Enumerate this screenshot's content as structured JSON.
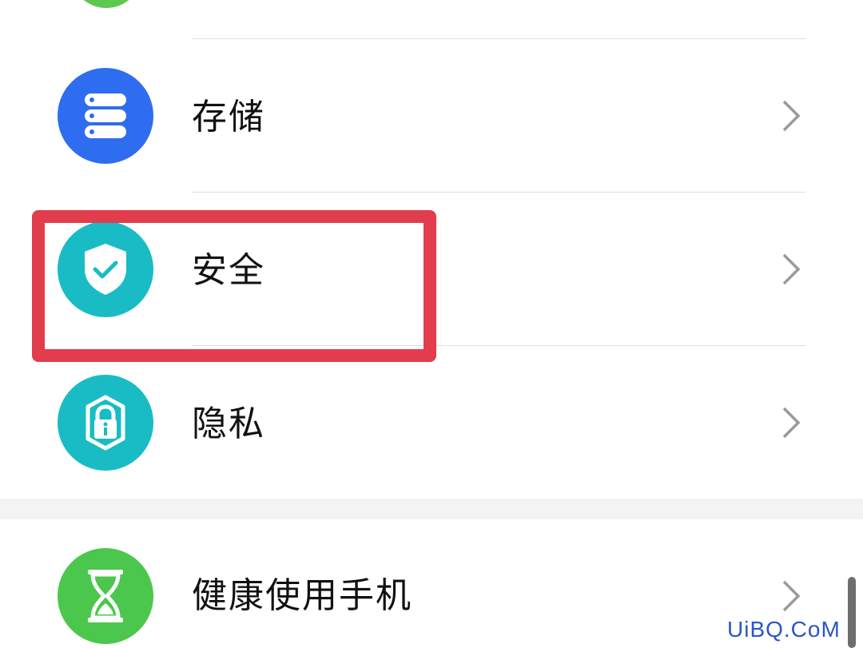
{
  "settings": {
    "items": [
      {
        "id": "storage",
        "label": "存储",
        "icon": "storage-icon",
        "color": "#2f6df0"
      },
      {
        "id": "security",
        "label": "安全",
        "icon": "shield-check-icon",
        "color": "#19bcc4"
      },
      {
        "id": "privacy",
        "label": "隐私",
        "icon": "privacy-lock-icon",
        "color": "#19bcc4"
      },
      {
        "id": "digital-balance",
        "label": "健康使用手机",
        "icon": "hourglass-icon",
        "color": "#4cc74d"
      }
    ],
    "top_partial_icon_color": "#5cc84f",
    "highlight_color": "#e23d4c"
  },
  "watermark": {
    "text": "UiBQ.CoM"
  }
}
